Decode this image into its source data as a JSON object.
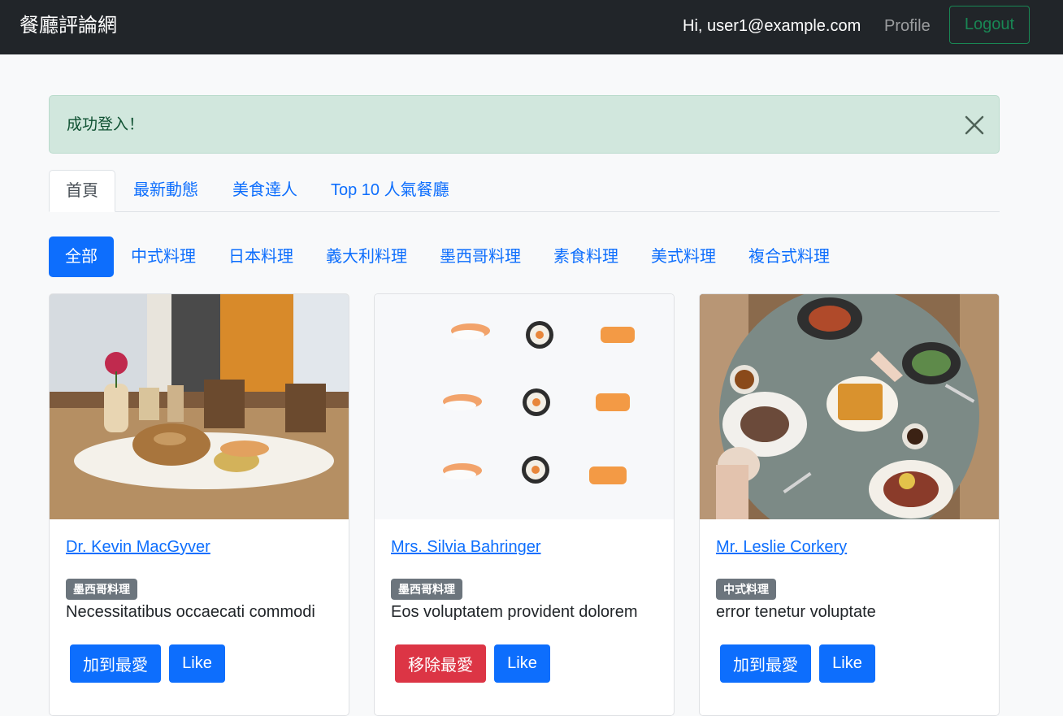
{
  "navbar": {
    "brand": "餐廳評論網",
    "user_greeting": "Hi, user1@example.com",
    "profile_label": "Profile",
    "logout_label": "Logout"
  },
  "alert": {
    "message": "成功登入！",
    "close_icon": "close-icon"
  },
  "tabs": [
    {
      "label": "首頁",
      "active": true
    },
    {
      "label": "最新動態",
      "active": false
    },
    {
      "label": "美食達人",
      "active": false
    },
    {
      "label": "Top 10 人氣餐廳",
      "active": false
    }
  ],
  "categories": [
    {
      "label": "全部",
      "active": true
    },
    {
      "label": "中式料理",
      "active": false
    },
    {
      "label": "日本料理",
      "active": false
    },
    {
      "label": "義大利料理",
      "active": false
    },
    {
      "label": "墨西哥料理",
      "active": false
    },
    {
      "label": "素食料理",
      "active": false
    },
    {
      "label": "美式料理",
      "active": false
    },
    {
      "label": "複合式料理",
      "active": false
    }
  ],
  "restaurants": [
    {
      "name": "Dr. Kevin MacGyver",
      "category": "墨西哥料理",
      "description": "Necessitatibus occaecati commodi",
      "favorite_label": "加到最愛",
      "like_label": "Like",
      "is_favorited": false,
      "image": "cafe-pastry-photo"
    },
    {
      "name": "Mrs. Silvia Bahringer",
      "category": "墨西哥料理",
      "description": "Eos voluptatem provident dolorem",
      "favorite_label": "移除最愛",
      "like_label": "Like",
      "is_favorited": true,
      "image": "sushi-photo"
    },
    {
      "name": "Mr. Leslie Corkery",
      "category": "中式料理",
      "description": "error tenetur voluptate",
      "favorite_label": "加到最愛",
      "like_label": "Like",
      "is_favorited": false,
      "image": "brunch-table-photo"
    }
  ],
  "colors": {
    "primary": "#0d6efd",
    "danger": "#dc3545",
    "success": "#198754",
    "navbar_bg": "#212529",
    "alert_bg": "#d1e7dd",
    "badge_bg": "#6c757d"
  }
}
